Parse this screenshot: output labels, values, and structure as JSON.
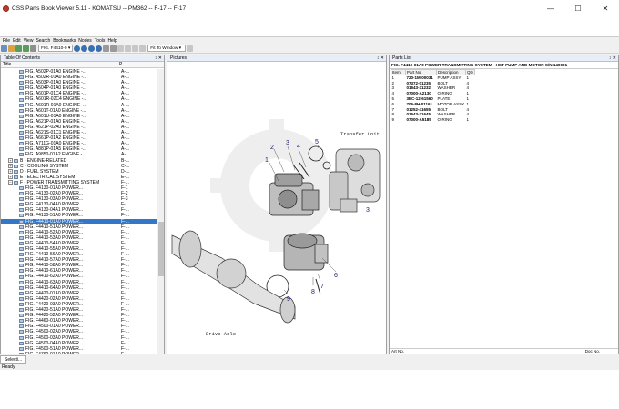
{
  "window": {
    "title": "CSS Parts Book Viewer 5.11 - KOMATSU -- PM362 -- F-17 -- F-17",
    "minimize": "—",
    "maximize": "☐",
    "close": "✕"
  },
  "menu": [
    "File",
    "Edit",
    "View",
    "Search",
    "Bookmarks",
    "Nodes",
    "Tools",
    "Help"
  ],
  "toolbar": {
    "page_select": "FIG. F4410-0 ▾",
    "zoom_select": "Fit To Window ▾"
  },
  "toc": {
    "title": "Table Of Contents",
    "col_title": "Title",
    "col_page": "P...",
    "rows": [
      {
        "label": "FIG. A502P-01A0 ENGINE -...",
        "page": "A-...",
        "type": "item"
      },
      {
        "label": "FIG. A502R-01A0 ENGINE -...",
        "page": "A-...",
        "type": "item"
      },
      {
        "label": "FIG. A503P-01A0 ENGINE -...",
        "page": "A-...",
        "type": "item"
      },
      {
        "label": "FIG. A504P-01A0 ENGINE -...",
        "page": "A-...",
        "type": "item"
      },
      {
        "label": "FIG. A601P-01C4 ENGINE -...",
        "page": "A-...",
        "type": "item"
      },
      {
        "label": "FIG. A601R-02C4 ENGINE -...",
        "page": "A-...",
        "type": "item"
      },
      {
        "label": "FIG. A601R-01A0 ENGINE -...",
        "page": "A-...",
        "type": "item"
      },
      {
        "label": "FIG. A601T-01A0 ENGINE -...",
        "page": "A-...",
        "type": "item"
      },
      {
        "label": "FIG. A601U-01A0 ENGINE -...",
        "page": "A-...",
        "type": "item"
      },
      {
        "label": "FIG. A621P-01A0 ENGINE -...",
        "page": "A-...",
        "type": "item"
      },
      {
        "label": "FIG. A621P-02A0 ENGINE -...",
        "page": "A-...",
        "type": "item"
      },
      {
        "label": "FIG. A621S-01C1 ENGINE -...",
        "page": "A-...",
        "type": "item"
      },
      {
        "label": "FIG. A661P-01A2 ENGINE -...",
        "page": "A-...",
        "type": "item"
      },
      {
        "label": "FIG. A711G-01A0 ENGINE -...",
        "page": "A-...",
        "type": "item"
      },
      {
        "label": "FIG. A881P-01A5 ENGINE -...",
        "page": "A-...",
        "type": "item"
      },
      {
        "label": "FIG. A9850-01A2 ENGINE -...",
        "page": "A-...",
        "type": "item"
      },
      {
        "label": "B - ENGINE-RELATED",
        "page": "B-...",
        "type": "group"
      },
      {
        "label": "C - COOLING SYSTEM",
        "page": "C-...",
        "type": "group"
      },
      {
        "label": "D - FUEL SYSTEM",
        "page": "D-...",
        "type": "group"
      },
      {
        "label": "E - ELECTRICAL SYSTEM",
        "page": "E-...",
        "type": "group"
      },
      {
        "label": "F - POWER TRANSMITTING SYSTEM",
        "page": "F-...",
        "type": "open"
      },
      {
        "label": "FIG. F4130-01A0 POWER...",
        "page": "F-1",
        "type": "item"
      },
      {
        "label": "FIG. F4130-02A0 POWER...",
        "page": "F-2",
        "type": "item"
      },
      {
        "label": "FIG. F4130-03A0 POWER...",
        "page": "F-3",
        "type": "item"
      },
      {
        "label": "FIG. F4130-04A0 POWER...",
        "page": "F-...",
        "type": "item"
      },
      {
        "label": "FIG. F4130-04A1 POWER...",
        "page": "F-...",
        "type": "item"
      },
      {
        "label": "FIG. F4130-51A0 POWER...",
        "page": "F-...",
        "type": "item"
      },
      {
        "label": "FIG. F4410-01A0 POWER...",
        "page": "F-...",
        "type": "selected"
      },
      {
        "label": "FIG. F4410-51A0 POWER...",
        "page": "F-...",
        "type": "item"
      },
      {
        "label": "FIG. F4410-52A0 POWER...",
        "page": "F-...",
        "type": "item"
      },
      {
        "label": "FIG. F4410-53A0 POWER...",
        "page": "F-...",
        "type": "item"
      },
      {
        "label": "FIG. F4410-54A0 POWER...",
        "page": "F-...",
        "type": "item"
      },
      {
        "label": "FIG. F4410-55A0 POWER...",
        "page": "F-...",
        "type": "item"
      },
      {
        "label": "FIG. F4410-56A0 POWER...",
        "page": "F-...",
        "type": "item"
      },
      {
        "label": "FIG. F4410-57A0 POWER...",
        "page": "F-...",
        "type": "item"
      },
      {
        "label": "FIG. F4410-58A0 POWER...",
        "page": "F-...",
        "type": "item"
      },
      {
        "label": "FIG. F4410-61A0 POWER...",
        "page": "F-...",
        "type": "item"
      },
      {
        "label": "FIG. F4410-62A0 POWER...",
        "page": "F-...",
        "type": "item"
      },
      {
        "label": "FIG. F4410-63A0 POWER...",
        "page": "F-...",
        "type": "item"
      },
      {
        "label": "FIG. F4410-64A0 POWER...",
        "page": "F-...",
        "type": "item"
      },
      {
        "label": "FIG. F4420-01A0 POWER...",
        "page": "F-...",
        "type": "item"
      },
      {
        "label": "FIG. F4420-02A0 POWER...",
        "page": "F-...",
        "type": "item"
      },
      {
        "label": "FIG. F4420-03A0 POWER...",
        "page": "F-...",
        "type": "item"
      },
      {
        "label": "FIG. F4420-51A0 POWER...",
        "page": "F-...",
        "type": "item"
      },
      {
        "label": "FIG. F4420-52A0 POWER...",
        "page": "F-...",
        "type": "item"
      },
      {
        "label": "FIG. F4460-01A0 POWER...",
        "page": "F-...",
        "type": "item"
      },
      {
        "label": "FIG. F4500-01A0 POWER...",
        "page": "F-...",
        "type": "item"
      },
      {
        "label": "FIG. F4500-02A0 POWER...",
        "page": "F-...",
        "type": "item"
      },
      {
        "label": "FIG. F4500-03A0 POWER...",
        "page": "F-...",
        "type": "item"
      },
      {
        "label": "FIG. F4500-04A0 POWER...",
        "page": "F-...",
        "type": "item"
      },
      {
        "label": "FIG. F4500-51A0 POWER...",
        "page": "F-...",
        "type": "item"
      },
      {
        "label": "FIG. F4760-01A0 POWER...",
        "page": "F-...",
        "type": "item"
      },
      {
        "label": "FIG. F4760-02A0 POWER...",
        "page": "F-...",
        "type": "item"
      }
    ]
  },
  "pictures": {
    "title": "Pictures",
    "labels": {
      "transfer": "Transfer Unit",
      "drive": "Drive Axle"
    },
    "callouts": [
      "1",
      "2",
      "3",
      "4",
      "5",
      "6",
      "7",
      "8",
      "9",
      "3"
    ]
  },
  "parts": {
    "title": "Parts List",
    "heading": "FIG. F4410-01A0 POWER TRANSMITTING SYSTEM - HST PUMP AND MOTOR S/N 140001~",
    "columns": [
      "Item",
      "Part No.",
      "Description",
      "Qty"
    ],
    "rows": [
      {
        "item": "1",
        "part": "720-1M-00031",
        "desc": "PUMP ASSY",
        "qty": "1"
      },
      {
        "item": "2",
        "part": "07372-01235",
        "desc": "BOLT",
        "qty": "4"
      },
      {
        "item": "3",
        "part": "01643-31232",
        "desc": "WASHER",
        "qty": "4"
      },
      {
        "item": "4",
        "part": "07000-A2130",
        "desc": "O-RING",
        "qty": "1"
      },
      {
        "item": "5",
        "part": "3EC-12-61560",
        "desc": "PLATE",
        "qty": "1"
      },
      {
        "item": "6",
        "part": "706-8H-01161",
        "desc": "MOTOR ASSY",
        "qty": "1"
      },
      {
        "item": "7",
        "part": "01252-41655",
        "desc": "BOLT",
        "qty": "4"
      },
      {
        "item": "8",
        "part": "01643-31645",
        "desc": "WASHER",
        "qty": "4"
      },
      {
        "item": "9",
        "part": "07000-A5185",
        "desc": "O-RING",
        "qty": "1"
      }
    ],
    "footer_left": "Art No.",
    "footer_right": "Doc No."
  },
  "bottom_tab": "Selecti...",
  "status": "Ready"
}
